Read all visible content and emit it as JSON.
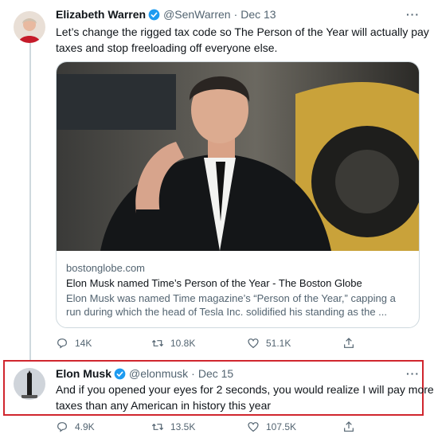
{
  "tweet1": {
    "name": "Elizabeth Warren",
    "handle": "@SenWarren",
    "sep": "·",
    "date": "Dec 13",
    "more": "···",
    "text_line1": "Let’s change the rigged tax code so The Person of the Year will actually pay",
    "text_line2": "taxes and stop freeloading off everyone else.",
    "card": {
      "domain": "bostonglobe.com",
      "title": "Elon Musk named Time’s Person of the Year - The Boston Globe",
      "desc_line1": "Elon Musk was named Time magazine’s “Person of the Year,” capping a",
      "desc_line2": "run during which the head of Tesla Inc. solidified his standing as the ..."
    },
    "replies": "14K",
    "retweets": "10.8K",
    "likes": "51.1K"
  },
  "tweet2": {
    "name": "Elon Musk",
    "handle": "@elonmusk",
    "sep": "·",
    "date": "Dec 15",
    "more": "···",
    "text_line1": "And if you opened your eyes for 2 seconds, you would realize I will pay more",
    "text_line2": "taxes than any American in history this year",
    "replies": "4.9K",
    "retweets": "13.5K",
    "likes": "107.5K"
  },
  "icons": {
    "verified": "verified-badge-icon",
    "reply": "reply-icon",
    "retweet": "retweet-icon",
    "like": "heart-icon",
    "share": "share-icon"
  },
  "colors": {
    "verified": "#1d9bf0",
    "highlight": "#d0262e",
    "muted": "#536471"
  }
}
